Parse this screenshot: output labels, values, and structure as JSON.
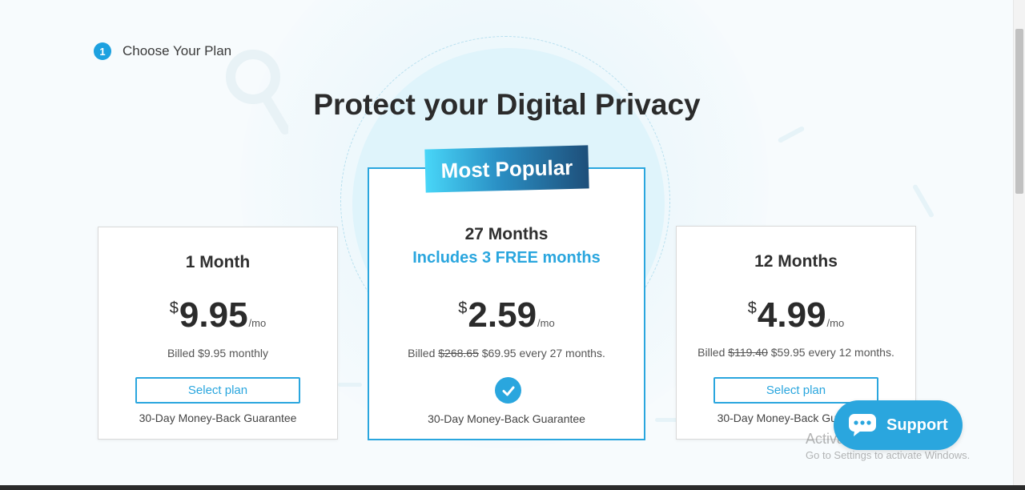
{
  "step": {
    "number": "1",
    "label": "Choose Your Plan"
  },
  "headline": "Protect your Digital Privacy",
  "badge": "Most Popular",
  "plans": [
    {
      "title": "1 Month",
      "currency": "$",
      "price": "9.95",
      "per": "/mo",
      "billed_prefix": "Billed $9.95 monthly",
      "billed_strike": "",
      "billed_suffix": "",
      "button": "Select plan",
      "guarantee": "30-Day Money-Back Guarantee"
    },
    {
      "title": "27 Months",
      "subtitle": "Includes 3 FREE months",
      "currency": "$",
      "price": "2.59",
      "per": "/mo",
      "billed_prefix": "Billed",
      "billed_strike": "$268.65",
      "billed_suffix": "$69.95 every 27 months.",
      "selected": true,
      "guarantee": "30-Day Money-Back Guarantee"
    },
    {
      "title": "12 Months",
      "currency": "$",
      "price": "4.99",
      "per": "/mo",
      "billed_prefix": "Billed",
      "billed_strike": "$119.40",
      "billed_suffix": "$59.95 every 12 months.",
      "button": "Select plan",
      "guarantee": "30-Day Money-Back Guarantee"
    }
  ],
  "support": {
    "label": "Support",
    "icon": "chat-bubble-icon"
  },
  "watermark": {
    "title": "Activate Windows",
    "subtitle": "Go to Settings to activate Windows."
  },
  "colors": {
    "accent": "#2aa6de",
    "text": "#2b2b2b",
    "background": "#f7fbfd"
  }
}
